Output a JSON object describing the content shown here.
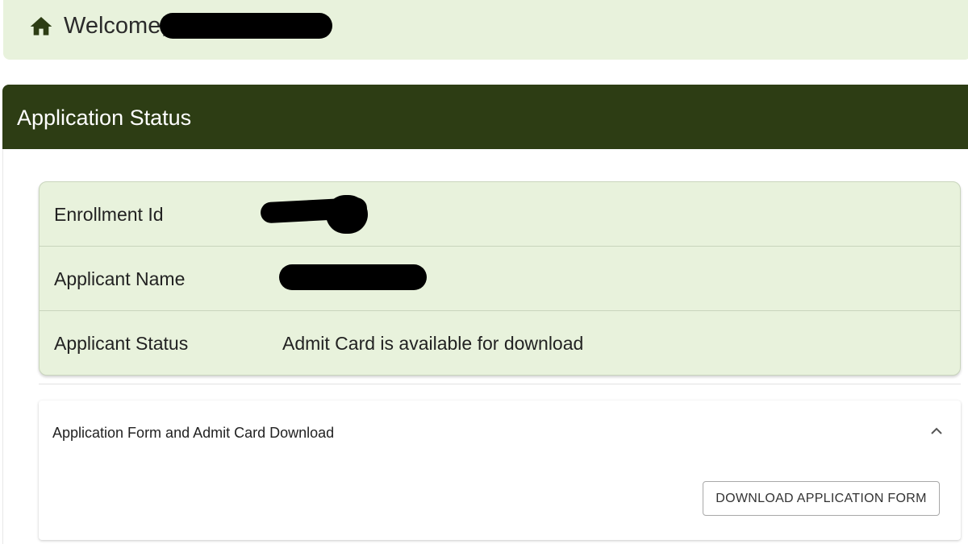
{
  "welcome": {
    "greeting": "Welcome,",
    "icon": "home-icon"
  },
  "application_status": {
    "title": "Application Status",
    "rows": [
      {
        "label": "Enrollment Id",
        "value": ""
      },
      {
        "label": "Applicant Name",
        "value": ""
      },
      {
        "label": "Applicant Status",
        "value": "Admit Card is available for download"
      }
    ]
  },
  "downloads": {
    "title": "Application Form and Admit Card Download",
    "icon": "chevron-up-icon",
    "button_label": "DOWNLOAD APPLICATION FORM"
  },
  "colors": {
    "header_bg": "#2d3d14",
    "light_green": "#e8f2dc",
    "home_icon": "#2d3d14"
  }
}
